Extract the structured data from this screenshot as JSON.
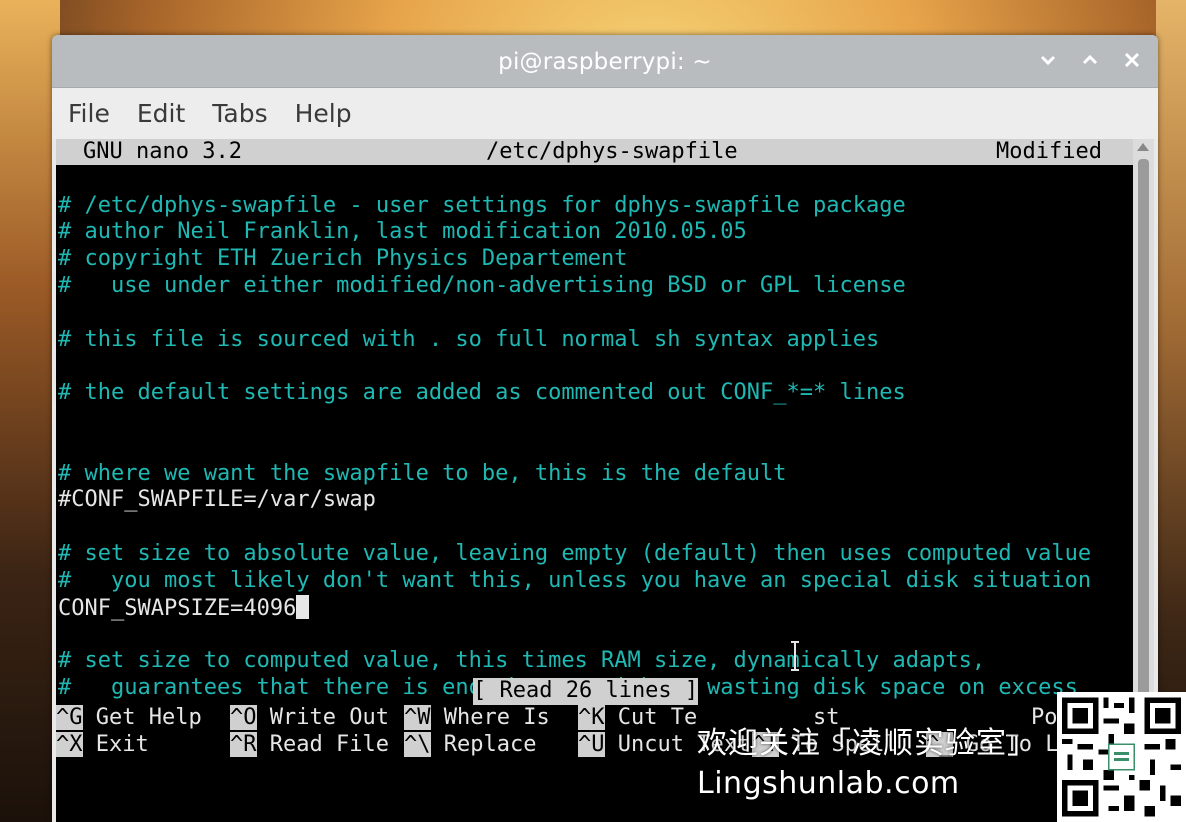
{
  "window": {
    "title": "pi@raspberrypi: ~",
    "controls": [
      "chevron-down-icon",
      "chevron-up-icon",
      "close-icon"
    ]
  },
  "menu": [
    "File",
    "Edit",
    "Tabs",
    "Help"
  ],
  "nano": {
    "version": "GNU nano 3.2",
    "filename": "/etc/dphys-swapfile",
    "state": "Modified",
    "lines": [
      {
        "row": 2,
        "kind": "comment",
        "text": "# /etc/dphys-swapfile - user settings for dphys-swapfile package"
      },
      {
        "row": 3,
        "kind": "comment",
        "text": "# author Neil Franklin, last modification 2010.05.05"
      },
      {
        "row": 4,
        "kind": "comment",
        "text": "# copyright ETH Zuerich Physics Departement"
      },
      {
        "row": 5,
        "kind": "comment",
        "text": "#   use under either modified/non-advertising BSD or GPL license"
      },
      {
        "row": 7,
        "kind": "comment",
        "text": "# this file is sourced with . so full normal sh syntax applies"
      },
      {
        "row": 9,
        "kind": "comment",
        "text": "# the default settings are added as commented out CONF_*=* lines"
      },
      {
        "row": 12,
        "kind": "comment",
        "text": "# where we want the swapfile to be, this is the default"
      },
      {
        "row": 13,
        "kind": "plain",
        "text": "#CONF_SWAPFILE=/var/swap"
      },
      {
        "row": 15,
        "kind": "comment",
        "text": "# set size to absolute value, leaving empty (default) then uses computed value"
      },
      {
        "row": 16,
        "kind": "comment",
        "text": "#   you most likely don't want this, unless you have an special disk situation"
      },
      {
        "row": 17,
        "kind": "plain",
        "text": "CONF_SWAPSIZE=4096"
      },
      {
        "row": 19,
        "kind": "comment",
        "text": "# set size to computed value, this times RAM size, dynamically adapts,"
      },
      {
        "row": 20,
        "kind": "comment",
        "text": "#   guarantees that there is enough swap without wasting disk space on excess"
      }
    ],
    "status_message": "[ Read 26 lines ]",
    "shortcuts_row1": [
      {
        "key": "^G",
        "label": "Get Help"
      },
      {
        "key": "^O",
        "label": "Write Out"
      },
      {
        "key": "^W",
        "label": "Where Is"
      },
      {
        "key": "^K",
        "label": "Cut Te"
      }
    ],
    "shortcuts_row2": [
      {
        "key": "^X",
        "label": "Exit"
      },
      {
        "key": "^R",
        "label": "Read File"
      },
      {
        "key": "^\\",
        "label": "Replace"
      },
      {
        "key": "^U",
        "label": "Uncut Text"
      },
      {
        "key": "^T",
        "label": "To Spell"
      },
      {
        "key": "^_",
        "label": "Go To L"
      }
    ],
    "partial_row1_tail": [
      {
        "label": "st"
      },
      {
        "label": "Pos"
      }
    ]
  },
  "watermark": {
    "chinese": "欢迎关注「凌顺实验室」",
    "url": "Lingshunlab.com"
  },
  "icons": {
    "qr": "qr-code-icon",
    "mouse": "ibeam-cursor-icon"
  },
  "colors": {
    "title_bar": "#b9bcbf",
    "comment": "#1fb8b3",
    "terminal_bg": "#000000",
    "nano_bar": "#d0d0d0"
  }
}
